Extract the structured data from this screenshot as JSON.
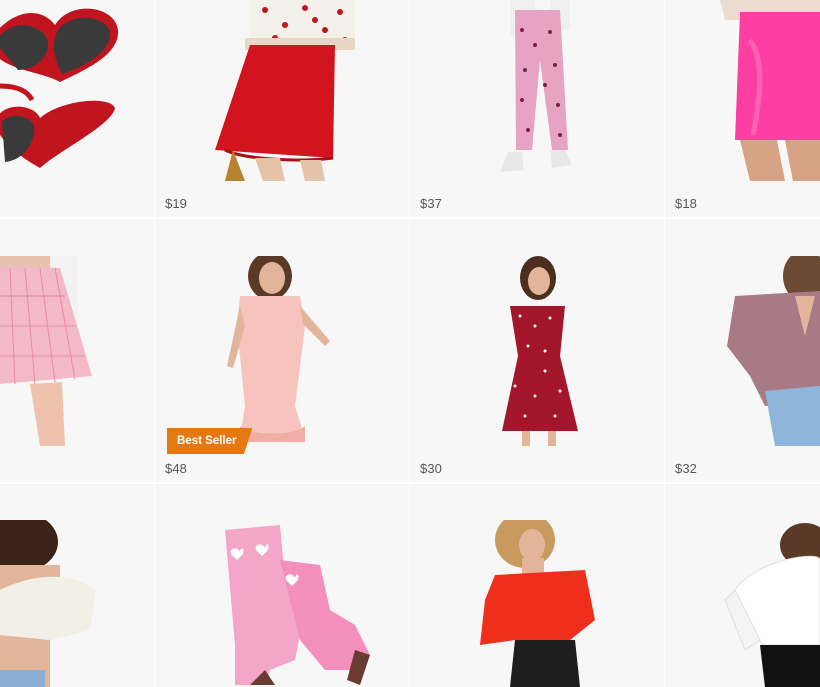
{
  "products": [
    {
      "name": "heart sunglasses",
      "price": ""
    },
    {
      "name": "red skirt",
      "price": "$19"
    },
    {
      "name": "pink polka pants",
      "price": "$37"
    },
    {
      "name": "pink mini skirt",
      "price": "$18"
    },
    {
      "name": "pink plaid skirt",
      "price": ""
    },
    {
      "name": "pink lace dress",
      "price": "$48",
      "badge": "Best Seller"
    },
    {
      "name": "red polka dress",
      "price": "$30"
    },
    {
      "name": "mauve corduroy shirt",
      "price": "$32"
    },
    {
      "name": "white puff crop top",
      "price": ""
    },
    {
      "name": "pink cowboy boots",
      "price": ""
    },
    {
      "name": "red off-shoulder top",
      "price": ""
    },
    {
      "name": "white wrap blouse",
      "price": ""
    }
  ],
  "colors": {
    "card_bg": "#f7f7f7",
    "badge_bg": "#e47911",
    "price_text": "#565959"
  }
}
